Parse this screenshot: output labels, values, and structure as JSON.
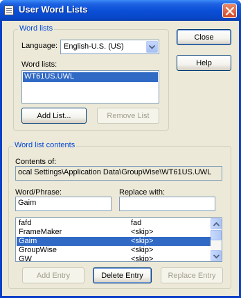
{
  "window": {
    "title": "User Word Lists"
  },
  "word_lists_group": {
    "legend": "Word lists",
    "language_label": "Language:",
    "language_value": "English-U.S.  (US)",
    "word_lists_label": "Word lists:",
    "items": [
      "WT61US.UWL"
    ],
    "add_list_button": "Add List...",
    "remove_list_button": "Remove List"
  },
  "buttons": {
    "close": "Close",
    "help": "Help"
  },
  "contents_group": {
    "legend": "Word list contents",
    "contents_of_label": "Contents of:",
    "contents_path": "ocal Settings\\Application Data\\GroupWise\\WT61US.UWL",
    "word_phrase_label": "Word/Phrase:",
    "word_phrase_value": "Gaim",
    "replace_with_label": "Replace with:",
    "replace_with_value": "",
    "entries": [
      {
        "word": "fafd",
        "replacement": "fad",
        "selected": false
      },
      {
        "word": "FrameMaker",
        "replacement": "<skip>",
        "selected": false
      },
      {
        "word": "Gaim",
        "replacement": "<skip>",
        "selected": true
      },
      {
        "word": "GroupWise",
        "replacement": "<skip>",
        "selected": false
      },
      {
        "word": "GW",
        "replacement": "<skip>",
        "selected": false
      }
    ],
    "add_entry_button": "Add Entry",
    "delete_entry_button": "Delete Entry",
    "replace_entry_button": "Replace Entry"
  },
  "colors": {
    "titlebar": "#0b4fd8",
    "dialog_bg": "#ece9d8",
    "group_legend": "#0046d5",
    "selection": "#316ac5",
    "close_button": "#d44a26"
  },
  "icons": [
    "window-icon",
    "close-icon",
    "dropdown-arrow-icon",
    "scroll-up-icon",
    "scroll-down-icon"
  ]
}
